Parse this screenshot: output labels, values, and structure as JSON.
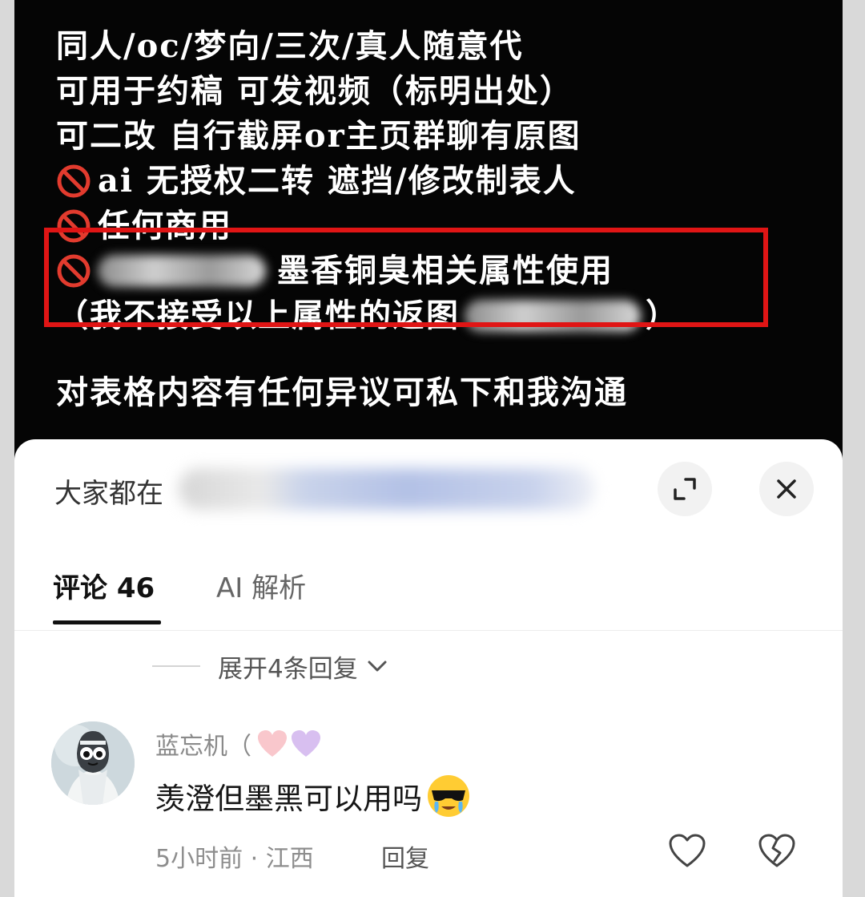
{
  "post": {
    "line1": "同人/oc/梦向/三次/真人随意代",
    "line2": "可用于约稿 可发视频（标明出处）",
    "line3": "可二改 自行截屏or主页群聊有原图",
    "line4": "ai 无授权二转 遮挡/修改制表人",
    "line5": "任何商用",
    "line6": "墨香铜臭相关属性使用",
    "line7_prefix": "（我不接受以上属性的返图",
    "line7_suffix": "）",
    "line8": "对表格内容有任何异议可私下和我沟通"
  },
  "sheet": {
    "title": "大家都在",
    "tabs": {
      "comments_label": "评论 46",
      "ai_label": "AI 解析"
    },
    "expand_replies": "展开4条回复"
  },
  "comment": {
    "username": "蓝忘机（",
    "text": "羡澄但墨黑可以用吗",
    "meta": "5小时前 · 江西",
    "reply_label": "回复"
  },
  "colors": {
    "highlight_border": "#e01515",
    "background_dark": "#050505",
    "sheet_bg": "#ffffff"
  },
  "icons": [
    "ban-icon",
    "expand-icon",
    "close-icon",
    "chevron-down-icon",
    "heart-icon",
    "broken-heart-icon",
    "emoji-cool-tears"
  ]
}
